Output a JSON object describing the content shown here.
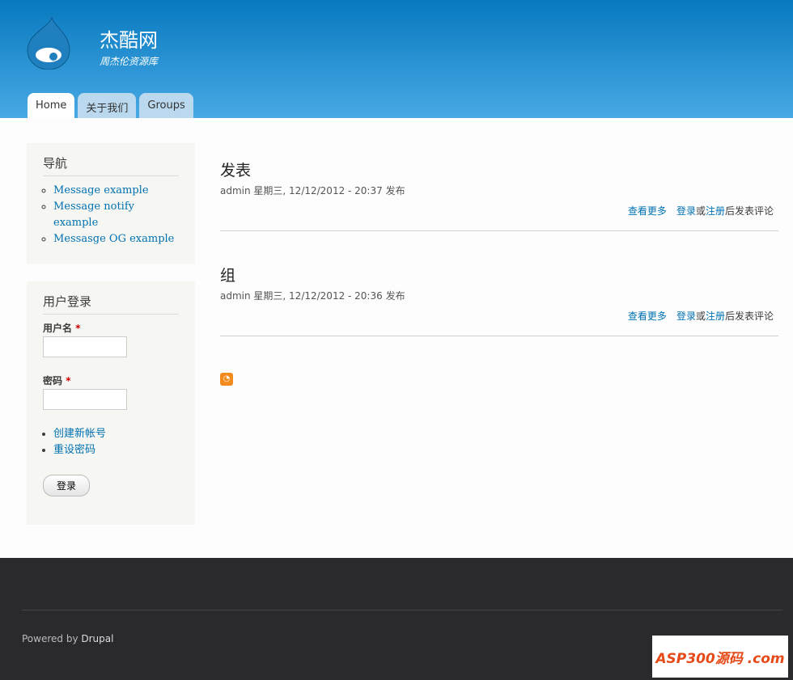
{
  "header": {
    "site_name": "杰酷网",
    "slogan": "周杰伦资源库"
  },
  "tabs": [
    {
      "label": "Home"
    },
    {
      "label": "关于我们"
    },
    {
      "label": "Groups"
    }
  ],
  "nav_block": {
    "title": "导航",
    "items": [
      "Message example",
      "Message notify example",
      "Messasge OG example"
    ]
  },
  "login_block": {
    "title": "用户登录",
    "username_label": "用户名",
    "password_label": "密码",
    "required": "*",
    "links": [
      "创建新帐号",
      "重设密码"
    ],
    "submit": "登录"
  },
  "nodes": [
    {
      "title": "发表",
      "meta": "admin 星期三, 12/12/2012 - 20:37 发布",
      "read_more": "查看更多",
      "login": "登录",
      "or": "或",
      "register": "注册",
      "suffix": "后发表评论"
    },
    {
      "title": "组",
      "meta": "admin 星期三, 12/12/2012 - 20:36 发布",
      "read_more": "查看更多",
      "login": "登录",
      "or": "或",
      "register": "注册",
      "suffix": "后发表评论"
    }
  ],
  "footer": {
    "powered": "Powered by ",
    "drupal": "Drupal",
    "badge": "ASP300源码 .com"
  }
}
